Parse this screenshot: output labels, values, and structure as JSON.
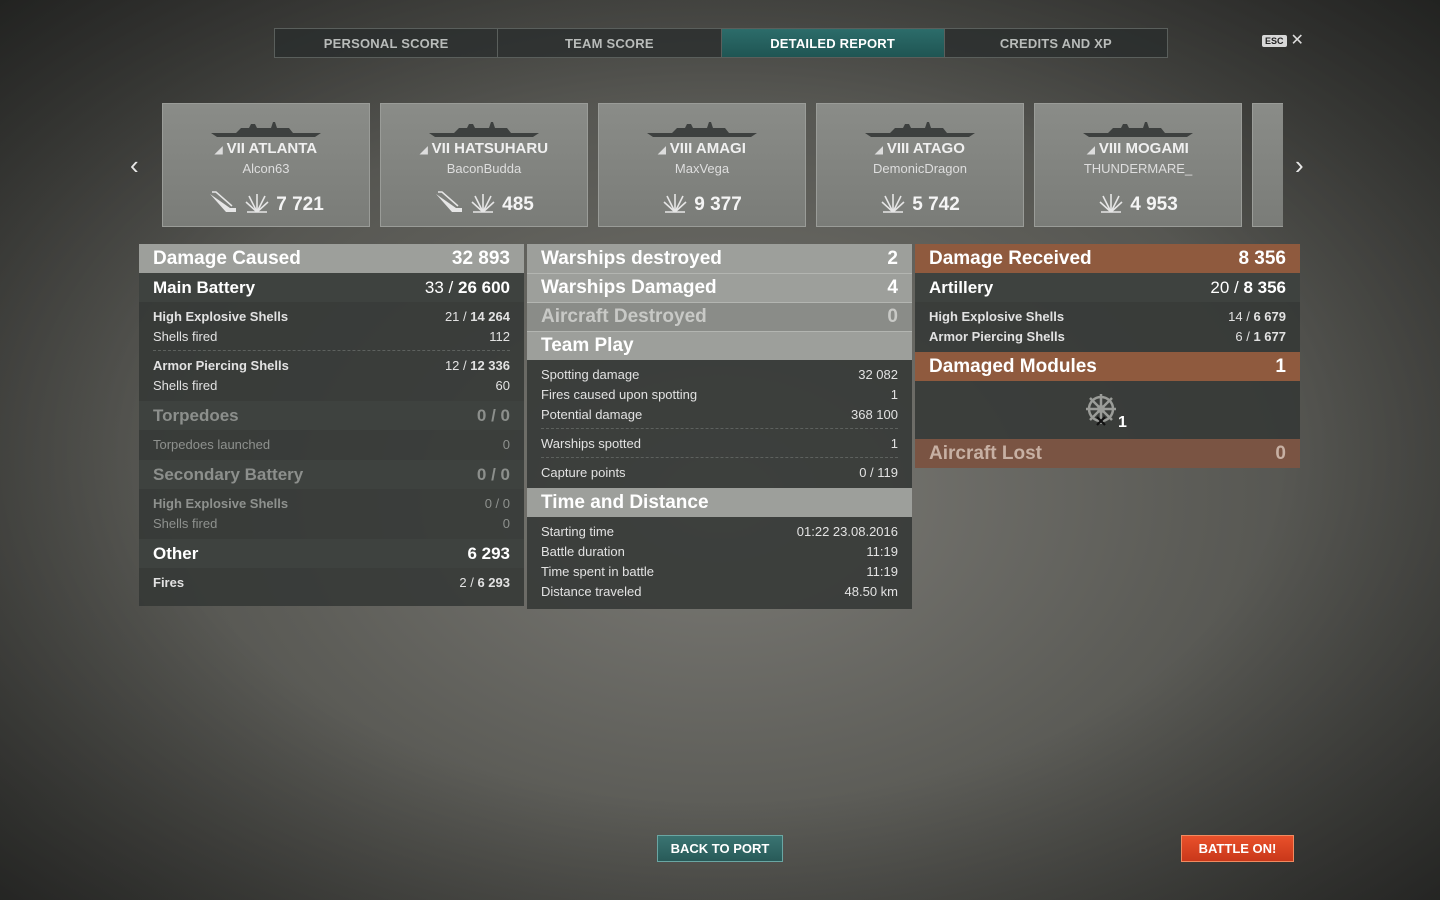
{
  "tabs": [
    "PERSONAL SCORE",
    "TEAM SCORE",
    "DETAILED REPORT",
    "CREDITS AND XP"
  ],
  "esc": {
    "key": "ESC",
    "close": "✕"
  },
  "nav": {
    "prev": "‹",
    "next": "›"
  },
  "cards": [
    {
      "tier_name": "VII ATLANTA",
      "player": "Alcon63",
      "value": "7 721",
      "torpedo_icon": true
    },
    {
      "tier_name": "VII HATSUHARU",
      "player": "BaconBudda",
      "value": "485",
      "torpedo_icon": true
    },
    {
      "tier_name": "VIII AMAGI",
      "player": "MaxVega",
      "value": "9 377",
      "torpedo_icon": false
    },
    {
      "tier_name": "VIII ATAGO",
      "player": "DemonicDragon",
      "value": "5 742",
      "torpedo_icon": false
    },
    {
      "tier_name": "VIII MOGAMI",
      "player": "THUNDERMARE_",
      "value": "4 953",
      "torpedo_icon": false
    }
  ],
  "left": {
    "damage_caused": {
      "label": "Damage Caused",
      "value": "32 893"
    },
    "main_battery": {
      "label": "Main Battery",
      "hits": "33 / ",
      "dmg": "26 600"
    },
    "he": {
      "label": "High Explosive Shells",
      "hits": "21 / ",
      "dmg": "14 264",
      "fired_label": "Shells fired",
      "fired": "112"
    },
    "ap": {
      "label": "Armor Piercing Shells",
      "hits": "12 / ",
      "dmg": "12 336",
      "fired_label": "Shells fired",
      "fired": "60"
    },
    "torpedoes": {
      "label": "Torpedoes",
      "value": "0 / 0",
      "launched_label": "Torpedoes launched",
      "launched": "0"
    },
    "secondary": {
      "label": "Secondary Battery",
      "value": "0 / 0",
      "he_label": "High Explosive Shells",
      "he_value": "0 / 0",
      "fired_label": "Shells fired",
      "fired": "0"
    },
    "other": {
      "label": "Other",
      "value": "6 293",
      "fires_label": "Fires",
      "fires_hits": "2 / ",
      "fires_dmg": "6 293"
    }
  },
  "middle": {
    "destroyed": {
      "label": "Warships destroyed",
      "value": "2"
    },
    "damaged": {
      "label": "Warships Damaged",
      "value": "4"
    },
    "aircraft": {
      "label": "Aircraft Destroyed",
      "value": "0"
    },
    "team_play": {
      "label": "Team Play",
      "rows": [
        {
          "k": "Spotting damage",
          "v": "32 082"
        },
        {
          "k": "Fires caused upon spotting",
          "v": "1"
        },
        {
          "k": "Potential damage",
          "v": "368 100"
        },
        {
          "k": "Warships spotted",
          "v": "1"
        },
        {
          "k": "Capture points",
          "v": "0 / 119"
        }
      ]
    },
    "time": {
      "label": "Time and Distance",
      "rows": [
        {
          "k": "Starting time",
          "v": "01:22  23.08.2016"
        },
        {
          "k": "Battle duration",
          "v": "11:19"
        },
        {
          "k": "Time spent in battle",
          "v": "11:19"
        },
        {
          "k": "Distance traveled",
          "v": "48.50 km"
        }
      ]
    }
  },
  "right": {
    "damage_received": {
      "label": "Damage Received",
      "value": "8 356"
    },
    "artillery": {
      "label": "Artillery",
      "hits": "20 / ",
      "dmg": "8 356"
    },
    "he": {
      "label": "High Explosive Shells",
      "hits": "14 / ",
      "dmg": "6 679"
    },
    "ap": {
      "label": "Armor Piercing Shells",
      "hits": "6 / ",
      "dmg": "1 677"
    },
    "modules": {
      "label": "Damaged Modules",
      "value": "1",
      "icon_count": "1"
    },
    "aircraft_lost": {
      "label": "Aircraft Lost",
      "value": "0"
    }
  },
  "buttons": {
    "back": "BACK TO PORT",
    "battle": "BATTLE ON!"
  },
  "colors": {
    "accent_teal": "#2c6c6a",
    "orange": "#8f5a3e",
    "battle": "#e9512b"
  }
}
